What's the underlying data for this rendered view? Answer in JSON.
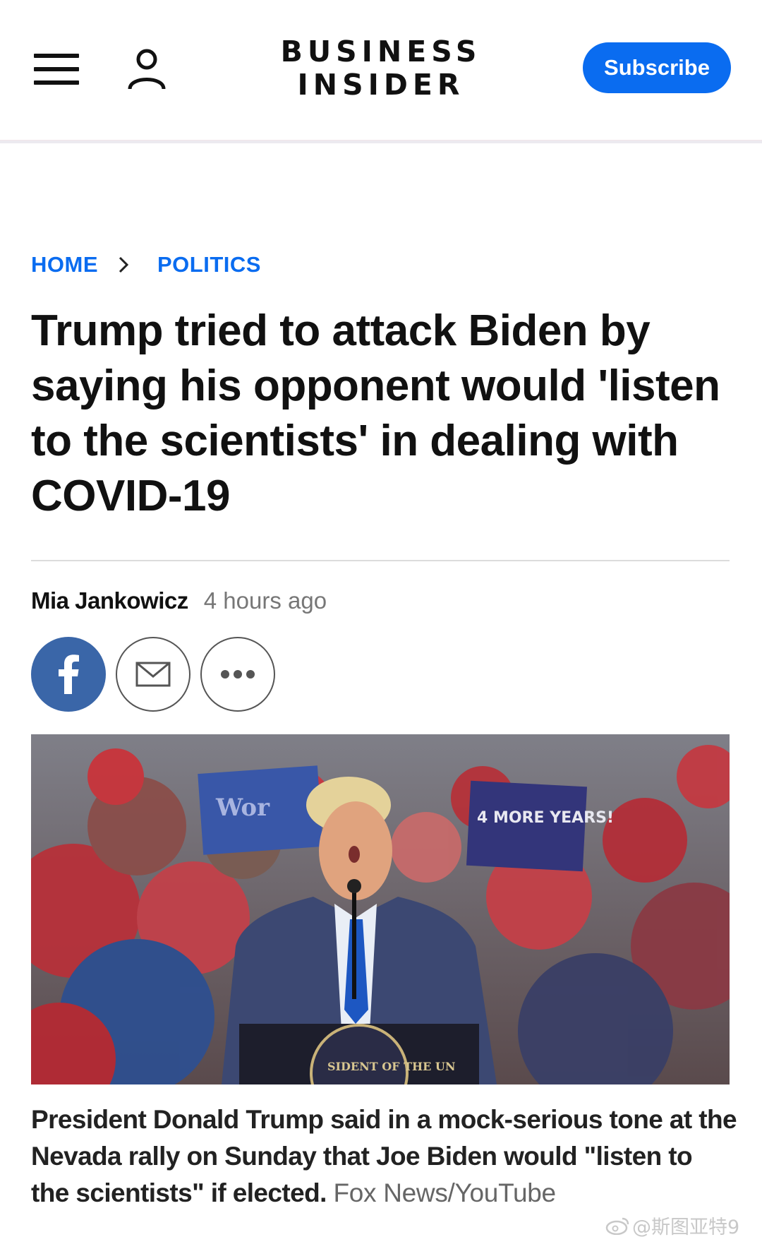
{
  "header": {
    "logo_line1": "BUSINESS",
    "logo_line2": "INSIDER",
    "subscribe_label": "Subscribe",
    "accent": "#0a6cf0",
    "menu_icon": "hamburger-icon",
    "account_icon": "user-icon"
  },
  "breadcrumb": {
    "items": [
      "HOME",
      "POLITICS"
    ],
    "separator_icon": "chevron-right-icon"
  },
  "article": {
    "headline": "Trump tried to attack Biden by saying his opponent would 'listen to the scientists' in dealing with COVID-19",
    "author": "Mia Jankowicz",
    "time": "4 hours ago",
    "share_icons": [
      "facebook-icon",
      "email-icon",
      "more-icon"
    ],
    "image_signs": [
      "4 MORE YEARS!",
      "Wor",
      "SIDENT OF THE UN"
    ],
    "caption": "President Donald Trump said in a mock-serious tone at the Nevada rally on Sunday that Joe Biden would \"listen to the scientists\" if elected.",
    "credit": "Fox News/YouTube"
  },
  "watermark": {
    "text": "@斯图亚特9"
  }
}
